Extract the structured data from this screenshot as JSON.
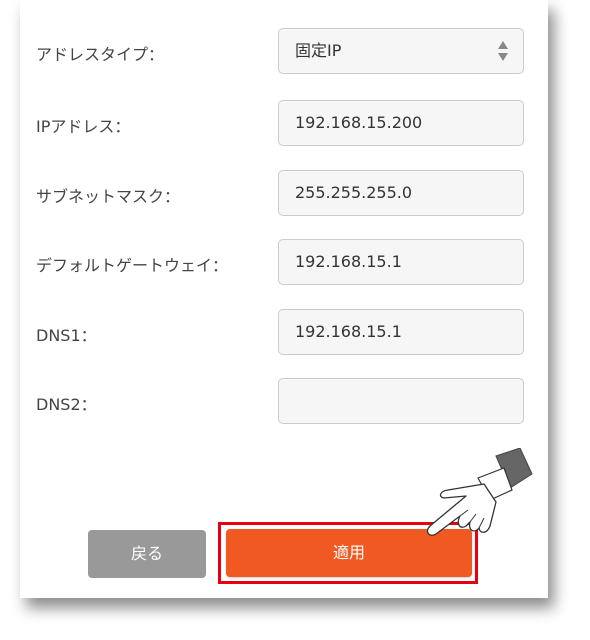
{
  "form": {
    "address_type": {
      "label": "アドレスタイプ：",
      "value": "固定IP"
    },
    "ip_address": {
      "label": "IPアドレス：",
      "value": "192.168.15.200"
    },
    "subnet_mask": {
      "label": "サブネットマスク：",
      "value": "255.255.255.0"
    },
    "default_gateway": {
      "label": "デフォルトゲートウェイ：",
      "value": "192.168.15.1"
    },
    "dns1": {
      "label": "DNS1：",
      "value": "192.168.15.1"
    },
    "dns2": {
      "label": "DNS2：",
      "value": ""
    }
  },
  "buttons": {
    "back_label": "戻る",
    "apply_label": "適用"
  },
  "colors": {
    "apply_button": "#f05a22",
    "back_button": "#999999",
    "highlight_frame": "#e60012",
    "field_background": "#f6f6f6"
  },
  "icons": {
    "select": "up-down-arrows-icon",
    "pointer": "pointing-hand-icon"
  }
}
